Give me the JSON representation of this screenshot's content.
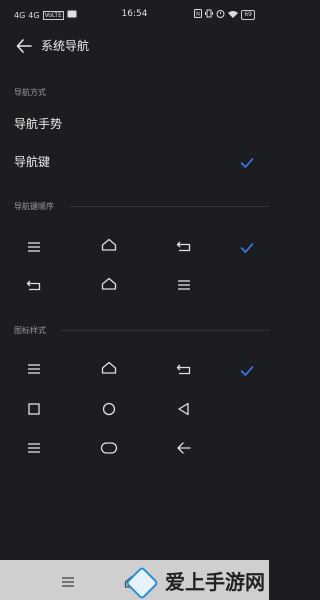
{
  "status_bar": {
    "left_icons": [
      "4G",
      "4G",
      "VoLTE",
      "message-icon"
    ],
    "time": "16:54",
    "right_icons": [
      "nfc-icon",
      "vibrate-icon",
      "alarm-icon",
      "wifi-icon"
    ],
    "battery": "69"
  },
  "header": {
    "title": "系统导航"
  },
  "sections": {
    "nav_method": {
      "label": "导航方式",
      "options": [
        {
          "label": "导航手势",
          "selected": false
        },
        {
          "label": "导航键",
          "selected": true
        }
      ]
    },
    "key_order": {
      "label": "导航键顺序",
      "rows": [
        {
          "icons": [
            "menu-icon",
            "home-icon",
            "back-icon"
          ],
          "selected": true
        },
        {
          "icons": [
            "back-icon",
            "home-icon",
            "menu-icon"
          ],
          "selected": false
        }
      ]
    },
    "icon_style": {
      "label": "图标样式",
      "rows": [
        {
          "icons": [
            "menu-icon",
            "home-icon",
            "back-icon"
          ],
          "selected": true
        },
        {
          "icons": [
            "square-icon",
            "circle-icon",
            "triangle-back-icon"
          ],
          "selected": false
        },
        {
          "icons": [
            "menu-icon",
            "rounded-rect-icon",
            "arrow-left-icon"
          ],
          "selected": false
        }
      ]
    }
  },
  "accent_color": "#3d7bf0",
  "watermark": {
    "text": "爱上手游网"
  }
}
